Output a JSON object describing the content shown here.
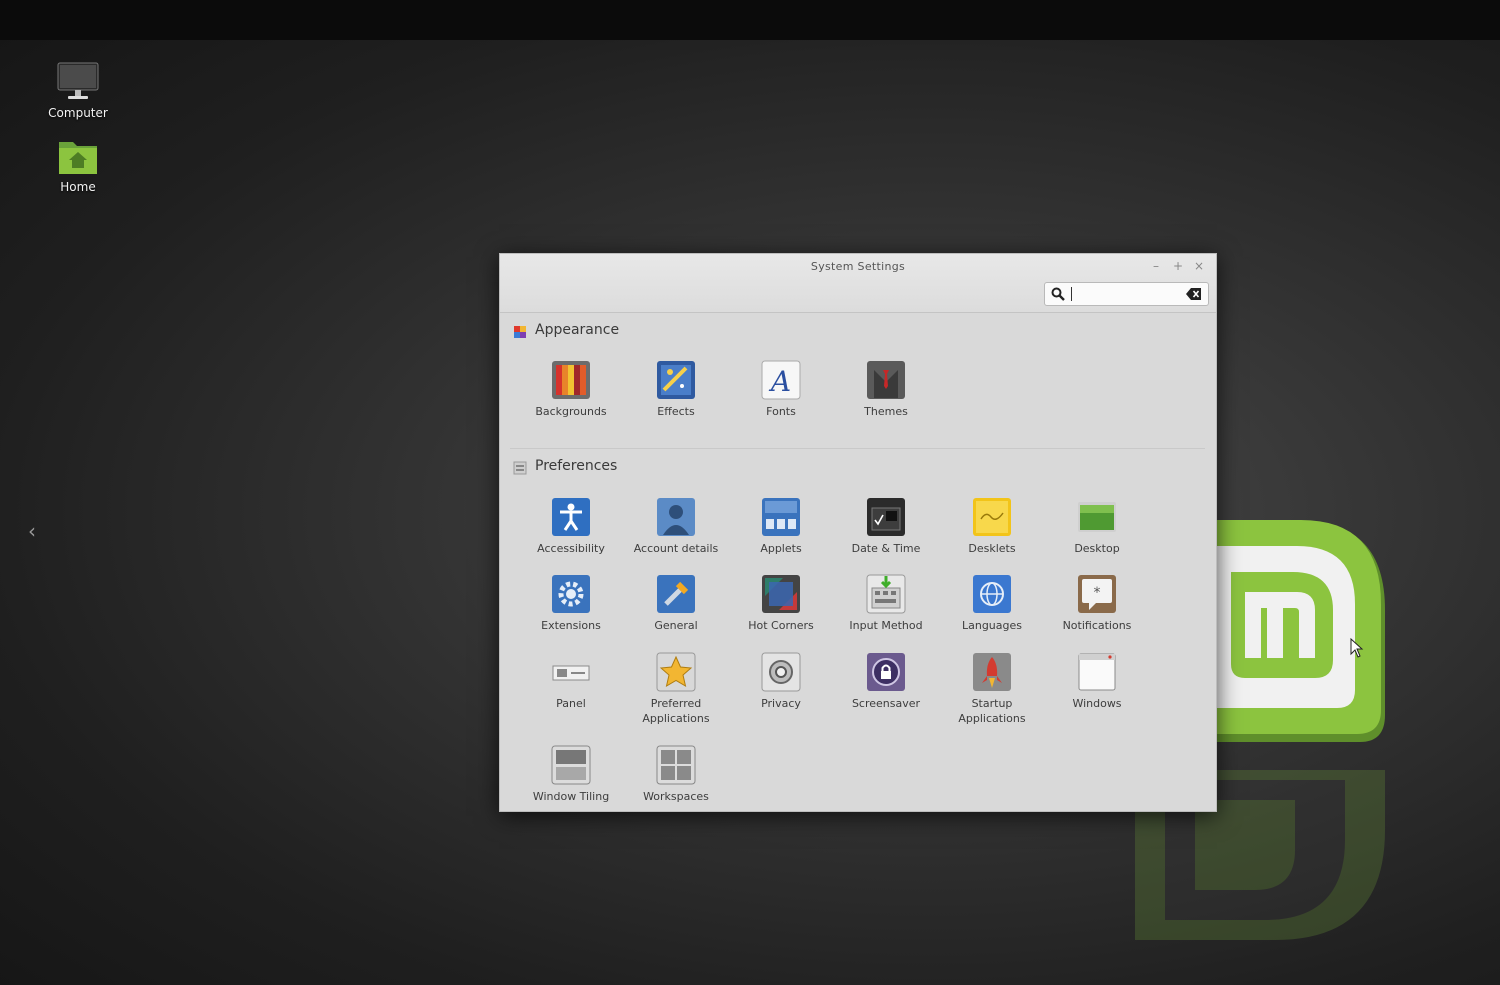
{
  "desktop": {
    "icons": [
      {
        "label": "Computer",
        "icon": "computer-icon"
      },
      {
        "label": "Home",
        "icon": "home-folder-icon"
      }
    ]
  },
  "window": {
    "title": "System Settings",
    "controls": {
      "minimize": "–",
      "maximize": "+",
      "close": "×"
    },
    "search": {
      "value": "",
      "placeholder": ""
    }
  },
  "sections": [
    {
      "title": "Appearance",
      "items": [
        {
          "label": "Backgrounds",
          "icon": "backgrounds-icon"
        },
        {
          "label": "Effects",
          "icon": "effects-icon"
        },
        {
          "label": "Fonts",
          "icon": "fonts-icon"
        },
        {
          "label": "Themes",
          "icon": "themes-icon"
        }
      ]
    },
    {
      "title": "Preferences",
      "items": [
        {
          "label": "Accessibility",
          "icon": "accessibility-icon"
        },
        {
          "label": "Account details",
          "icon": "account-icon"
        },
        {
          "label": "Applets",
          "icon": "applets-icon"
        },
        {
          "label": "Date & Time",
          "icon": "date-time-icon"
        },
        {
          "label": "Desklets",
          "icon": "desklets-icon"
        },
        {
          "label": "Desktop",
          "icon": "desktop-icon"
        },
        {
          "label": "Extensions",
          "icon": "extensions-icon"
        },
        {
          "label": "General",
          "icon": "general-icon"
        },
        {
          "label": "Hot Corners",
          "icon": "hot-corners-icon"
        },
        {
          "label": "Input Method",
          "icon": "input-method-icon"
        },
        {
          "label": "Languages",
          "icon": "languages-icon"
        },
        {
          "label": "Notifications",
          "icon": "notifications-icon"
        },
        {
          "label": "Panel",
          "icon": "panel-icon"
        },
        {
          "label": "Preferred\nApplications",
          "icon": "preferred-apps-icon"
        },
        {
          "label": "Privacy",
          "icon": "privacy-icon"
        },
        {
          "label": "Screensaver",
          "icon": "screensaver-icon"
        },
        {
          "label": "Startup\nApplications",
          "icon": "startup-apps-icon"
        },
        {
          "label": "Windows",
          "icon": "windows-icon"
        },
        {
          "label": "Window Tiling",
          "icon": "window-tiling-icon"
        },
        {
          "label": "Workspaces",
          "icon": "workspaces-icon"
        }
      ]
    }
  ],
  "colors": {
    "mint_green": "#8cc43f",
    "mint_dark": "#5a8a26",
    "window_bg": "#d9d9d9"
  }
}
